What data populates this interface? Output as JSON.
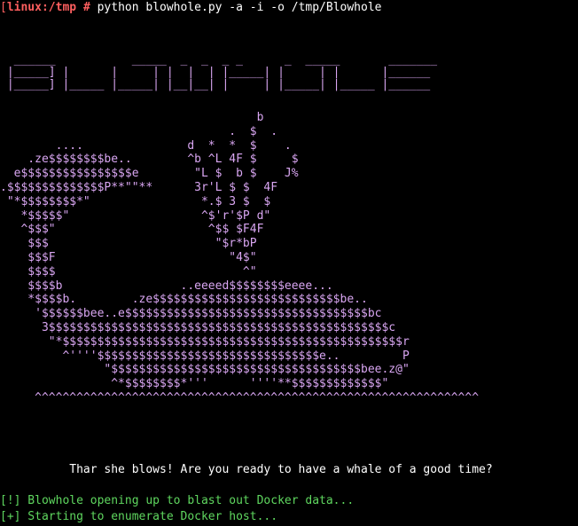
{
  "terminal": {
    "prompt": {
      "open_bracket": "[",
      "host_path": "linux:/tmp",
      "hash": "#",
      "command": "python blowhole.py -a -i -o /tmp/Blowhole"
    },
    "banner_art": "  ______           _____  _  _  _ _      _  _____       _______\n |_____] |      |     | |  |  | |_____| |     | |      |______\n |_____] |_____ |_____| |__|__| |     | |_____| |_____ |______",
    "whale_art": "                                     b\n                                 .  $  .\n        ....               d  *  *  $    .\n    .ze$$$$$$$$be..        ^b ^L 4F $     $\n  e$$$$$$$$$$$$$$$$e        \"L $  b $    J%\n.$$$$$$$$$$$$$$P**\"\"**      3r'L $ $  4F\n \"*$$$$$$$$*\"                *.$ 3 $  $\n   *$$$$$\"                   ^$'r'$P d\"\n   ^$$$\"                      ^$$ $F4F\n    $$$                        \"$r*bP\n    $$$F                         \"4$\"\n    $$$$                           ^\"\n    $$$$b                 ..eeeed$$$$$$$$eeee...\n    *$$$$b.        .ze$$$$$$$$$$$$$$$$$$$$$$$$$$$be..\n     '$$$$$$bee..e$$$$$$$$$$$$$$$$$$$$$$$$$$$$$$$$$$$bc\n      3$$$$$$$$$$$$$$$$$$$$$$$$$$$$$$$$$$$$$$$$$$$$$$$$$c\n       \"*$$$$$$$$$$$$$$$$$$$$$$$$$$$$$$$$$$$$$$$$$$$$$$$$$r\n         ^''''$$$$$$$$$$$$$$$$$$$$$$$$$$$$$$$$e..         P\n               \"$$$$$$$$$$$$$$$$$$$$$$$$$$$$$$$$$$$$bee.z@\"\n                ^*$$$$$$$$*'''      ''''**$$$$$$$$$$$$$\"\n     ^^^^^^^^^^^^^^^^^^^^^^^^^^^^^^^^^^^^^^^^^^^^^^^^^^^^^^^^^^^^^^^^",
    "tagline": "          Thar she blows! Are you ready to have a whale of a good time?",
    "info_lines": [
      "[!] Blowhole opening up to blast out Docker data...",
      "[+] Starting to enumerate Docker host..."
    ],
    "colors": {
      "background": "#000000",
      "prompt": "#ff5f5f",
      "art": "#d9a6f2",
      "info": "#5fd75f",
      "text": "#ffffff"
    }
  }
}
